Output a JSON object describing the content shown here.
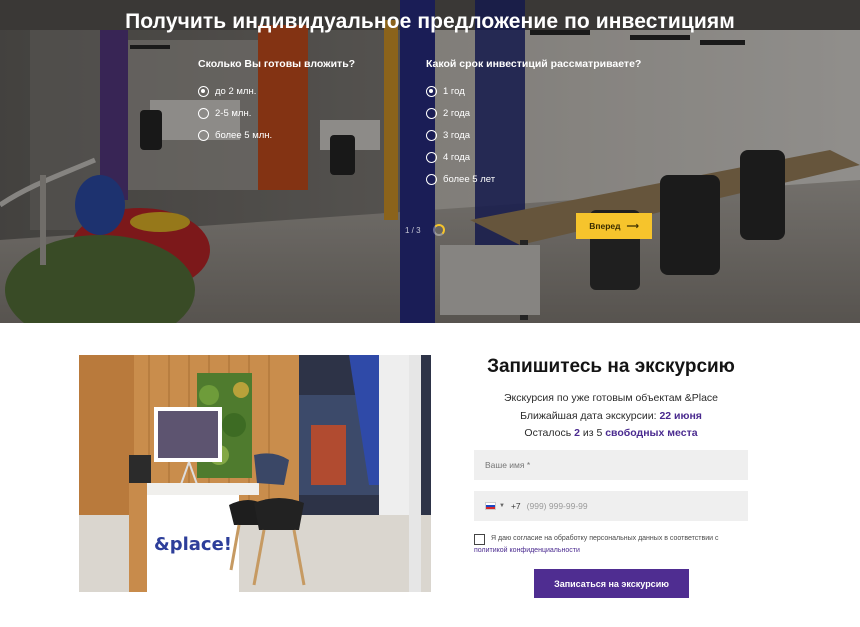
{
  "hero": {
    "title": "Получить индивидуальное предложение по инвестициям",
    "question1": {
      "title": "Сколько Вы готовы вложить?",
      "options": [
        "до 2 млн.",
        "2-5 млн.",
        "более 5 млн."
      ],
      "selected": 0
    },
    "question2": {
      "title": "Какой срок инвестиций рассматриваете?",
      "options": [
        "1 год",
        "2 года",
        "3 года",
        "4 года",
        "более 5 лет"
      ],
      "selected": 0
    },
    "step": "1 / 3",
    "next_label": "Вперед",
    "next_arrow": "⟶",
    "colors": {
      "accent_yellow": "#f6c42c"
    }
  },
  "form": {
    "title": "Запишитесь на экскурсию",
    "line1": "Экскурсия по уже готовым объектам &Place",
    "line2_prefix": "Ближайшая дата экскурсии: ",
    "line2_date": "22 июня",
    "line3_prefix": "Осталось ",
    "line3_count": "2",
    "line3_mid": " из 5 ",
    "line3_suffix": "свободных места",
    "name_placeholder": "Ваше имя *",
    "phone_code": "+7",
    "phone_placeholder": "(999) 999-99-99",
    "consent_text": "Я даю согласие на обработку персональных данных в соответствии с",
    "consent_link": "политикой конфиденциальности",
    "submit_label": "Записаться на экскурсию",
    "colors": {
      "accent_purple": "#4f2d91"
    }
  },
  "photo": {
    "logo_text": "&place!"
  }
}
